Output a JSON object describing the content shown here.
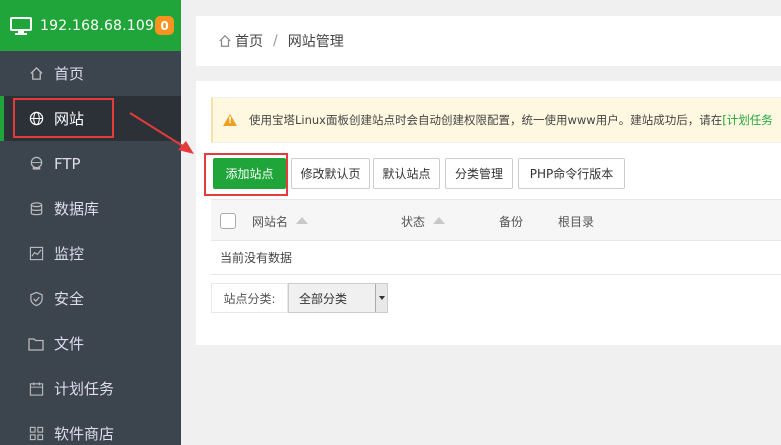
{
  "sidebar": {
    "server_ip": "192.168.68.109",
    "badge_count": "0",
    "items": [
      {
        "label": "首页",
        "icon": "home-icon"
      },
      {
        "label": "网站",
        "icon": "globe-icon",
        "active": true
      },
      {
        "label": "FTP",
        "icon": "ftp-icon"
      },
      {
        "label": "数据库",
        "icon": "database-icon"
      },
      {
        "label": "监控",
        "icon": "monitor-chart-icon"
      },
      {
        "label": "安全",
        "icon": "shield-icon"
      },
      {
        "label": "文件",
        "icon": "folder-icon"
      },
      {
        "label": "计划任务",
        "icon": "calendar-icon"
      },
      {
        "label": "软件商店",
        "icon": "grid-apps-icon"
      }
    ],
    "accent_color": "#20a53a"
  },
  "breadcrumb": {
    "home": "首页",
    "separator": "/",
    "current": "网站管理"
  },
  "notice": {
    "text": "使用宝塔Linux面板创建站点时会自动创建权限配置，统一使用www用户。建站成功后，请在",
    "link": "[计划任务"
  },
  "toolbar": {
    "add_site": "添加站点",
    "modify_default_page": "修改默认页",
    "default_site": "默认站点",
    "category_manage": "分类管理",
    "php_cli_version": "PHP命令行版本"
  },
  "table": {
    "columns": [
      "网站名",
      "状态",
      "备份",
      "根目录"
    ],
    "empty_text": "当前没有数据"
  },
  "filter": {
    "label": "站点分类:",
    "selected": "全部分类"
  },
  "highlight_color": "#e53b3b"
}
